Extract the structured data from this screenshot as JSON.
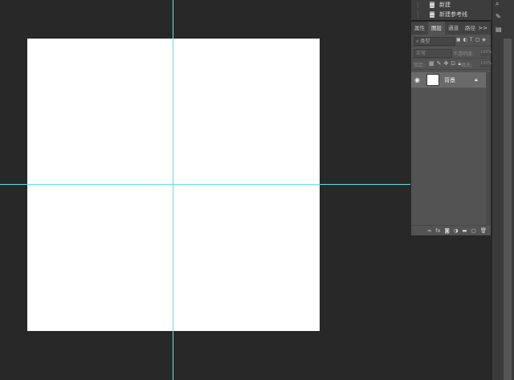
{
  "history": {
    "items": [
      {
        "label": "新建",
        "icon": "document-icon"
      },
      {
        "label": "新建参考线",
        "icon": "document-icon"
      }
    ]
  },
  "layers_panel": {
    "tabs": [
      {
        "label": "属性",
        "active": false
      },
      {
        "label": "图层",
        "active": true
      },
      {
        "label": "通道",
        "active": false
      },
      {
        "label": "路径",
        "active": false
      }
    ],
    "menu_glyph": ">>",
    "filter": {
      "placeholder": "类型"
    },
    "blend_mode": "正常",
    "opacity_label": "不透明度:",
    "opacity_value": "100%",
    "lock_label": "锁定:",
    "fill_label": "填充:",
    "fill_value": "100%",
    "layers": [
      {
        "name": "背景",
        "visible": true,
        "locked": true
      }
    ],
    "bottom_icons": [
      "link-icon",
      "fx-icon",
      "mask-icon",
      "adjustment-icon",
      "folder-icon",
      "new-layer-icon",
      "trash-icon"
    ]
  },
  "colors": {
    "workspace_bg": "#282828",
    "panel_bg": "#535353",
    "guide": "#5fe2e8",
    "document": "#ffffff"
  }
}
